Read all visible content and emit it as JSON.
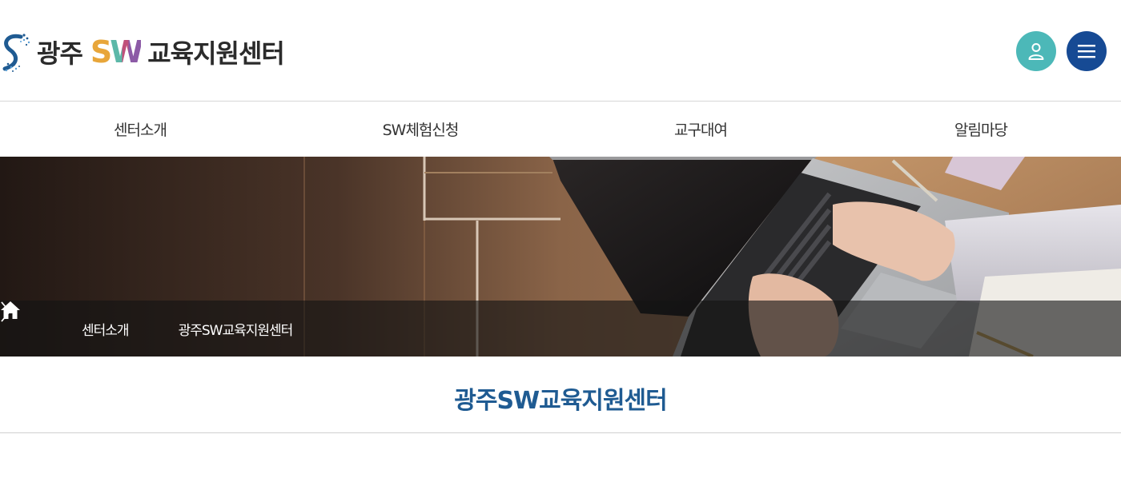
{
  "header": {
    "logo": {
      "prefix": "광주",
      "sw_letters": [
        "S",
        "W"
      ],
      "suffix": "교육지원센터"
    },
    "user_button_icon": "user-icon",
    "menu_button_icon": "hamburger-menu-icon"
  },
  "nav": {
    "items": [
      {
        "label": "센터소개"
      },
      {
        "label": "SW체험신청"
      },
      {
        "label": "교구대여"
      },
      {
        "label": "알림마당"
      }
    ]
  },
  "breadcrumb": {
    "home_icon": "home-icon",
    "separator_icon": "chevron-right-icon",
    "items": [
      {
        "label": "센터소개"
      },
      {
        "label": "광주SW교육지원센터"
      }
    ]
  },
  "main": {
    "title": "광주SW교육지원센터"
  },
  "colors": {
    "title_blue": "#1f5b92",
    "user_button": "#4cb8b8",
    "menu_button": "#164a94",
    "logo_s": "#e8a63a",
    "logo_w_green": "#5cb8a8",
    "logo_w_purple": "#8c5aa6"
  }
}
